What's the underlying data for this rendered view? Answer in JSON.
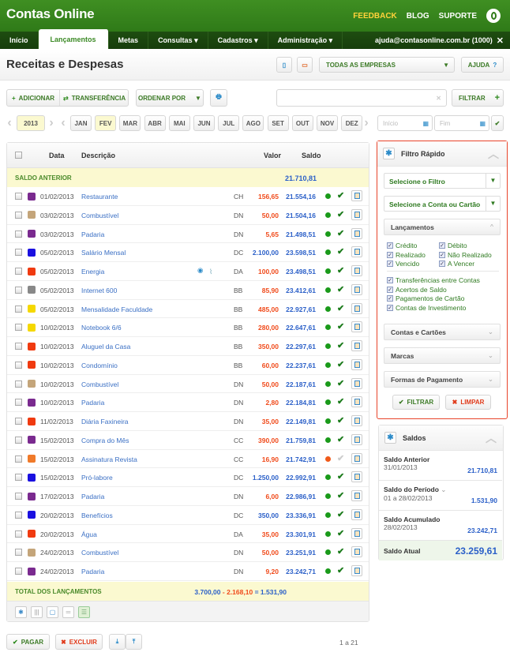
{
  "app": {
    "title": "Contas Online",
    "links": [
      "FEEDBACK",
      "BLOG",
      "SUPORTE"
    ]
  },
  "nav": {
    "items": [
      "Início",
      "Lançamentos",
      "Metas",
      "Consultas ▾",
      "Cadastros ▾",
      "Administração ▾"
    ],
    "active": 1,
    "user": "ajuda@contasonline.com.br (1000)"
  },
  "page": {
    "title": "Receitas e Despesas",
    "company_select": "TODAS AS EMPRESAS",
    "help": "AJUDA"
  },
  "toolbar": {
    "add": "ADICIONAR",
    "transfer": "TRANSFERÊNCIA",
    "order": "ORDENAR POR",
    "search_value": "",
    "filter": "FILTRAR"
  },
  "period": {
    "year": "2013",
    "months": [
      "JAN",
      "FEV",
      "MAR",
      "ABR",
      "MAI",
      "JUN",
      "JUL",
      "AGO",
      "SET",
      "OUT",
      "NOV",
      "DEZ"
    ],
    "selected_month": "FEV",
    "start_placeholder": "Início",
    "end_placeholder": "Fim"
  },
  "table": {
    "headers": {
      "data": "Data",
      "descricao": "Descrição",
      "valor": "Valor",
      "saldo": "Saldo"
    },
    "saldo_anterior": {
      "label": "SALDO ANTERIOR",
      "value": "21.710,81"
    },
    "rows": [
      {
        "date": "01/02/2013",
        "color": "#7a2a8f",
        "desc": "Restaurante",
        "code": "CH",
        "value": "156,65",
        "type": "debit",
        "saldo": "21.554,16",
        "status": "green",
        "paid": true
      },
      {
        "date": "03/02/2013",
        "color": "#c4a57a",
        "desc": "Combustível",
        "code": "DN",
        "value": "50,00",
        "type": "debit",
        "saldo": "21.504,16",
        "status": "green",
        "paid": true
      },
      {
        "date": "03/02/2013",
        "color": "#7a2a8f",
        "desc": "Padaria",
        "code": "DN",
        "value": "5,65",
        "type": "debit",
        "saldo": "21.498,51",
        "status": "green",
        "paid": true
      },
      {
        "date": "05/02/2013",
        "color": "#1a10e0",
        "desc": "Salário Mensal",
        "code": "DC",
        "value": "2.100,00",
        "type": "credit",
        "saldo": "23.598,51",
        "status": "green",
        "paid": true
      },
      {
        "date": "05/02/2013",
        "color": "#f03a10",
        "desc": "Energia",
        "code": "DA",
        "value": "100,00",
        "type": "debit",
        "saldo": "23.498,51",
        "status": "green",
        "paid": true,
        "icons": [
          "comment-icon",
          "attachment-icon"
        ]
      },
      {
        "date": "05/02/2013",
        "color": "#888888",
        "desc": "Internet 600",
        "code": "BB",
        "value": "85,90",
        "type": "debit",
        "saldo": "23.412,61",
        "status": "green",
        "paid": true
      },
      {
        "date": "05/02/2013",
        "color": "#f5d800",
        "desc": "Mensalidade Faculdade",
        "code": "BB",
        "value": "485,00",
        "type": "debit",
        "saldo": "22.927,61",
        "status": "green",
        "paid": true
      },
      {
        "date": "10/02/2013",
        "color": "#f5d800",
        "desc": "Notebook 6/6",
        "code": "BB",
        "value": "280,00",
        "type": "debit",
        "saldo": "22.647,61",
        "status": "green",
        "paid": true
      },
      {
        "date": "10/02/2013",
        "color": "#f03a10",
        "desc": "Aluguel da Casa",
        "code": "BB",
        "value": "350,00",
        "type": "debit",
        "saldo": "22.297,61",
        "status": "green",
        "paid": true
      },
      {
        "date": "10/02/2013",
        "color": "#f03a10",
        "desc": "Condomínio",
        "code": "BB",
        "value": "60,00",
        "type": "debit",
        "saldo": "22.237,61",
        "status": "green",
        "paid": true
      },
      {
        "date": "10/02/2013",
        "color": "#c4a57a",
        "desc": "Combustível",
        "code": "DN",
        "value": "50,00",
        "type": "debit",
        "saldo": "22.187,61",
        "status": "green",
        "paid": true
      },
      {
        "date": "10/02/2013",
        "color": "#7a2a8f",
        "desc": "Padaria",
        "code": "DN",
        "value": "2,80",
        "type": "debit",
        "saldo": "22.184,81",
        "status": "green",
        "paid": true
      },
      {
        "date": "11/02/2013",
        "color": "#f03a10",
        "desc": "Diária Faxineira",
        "code": "DN",
        "value": "35,00",
        "type": "debit",
        "saldo": "22.149,81",
        "status": "green",
        "paid": true
      },
      {
        "date": "15/02/2013",
        "color": "#7a2a8f",
        "desc": "Compra do Mês",
        "code": "CC",
        "value": "390,00",
        "type": "debit",
        "saldo": "21.759,81",
        "status": "green",
        "paid": true
      },
      {
        "date": "15/02/2013",
        "color": "#f07a2a",
        "desc": "Assinatura Revista",
        "code": "CC",
        "value": "16,90",
        "type": "debit",
        "saldo": "21.742,91",
        "status": "orange",
        "paid": false
      },
      {
        "date": "15/02/2013",
        "color": "#1a10e0",
        "desc": "Pró-labore",
        "code": "DC",
        "value": "1.250,00",
        "type": "credit",
        "saldo": "22.992,91",
        "status": "green",
        "paid": true
      },
      {
        "date": "17/02/2013",
        "color": "#7a2a8f",
        "desc": "Padaria",
        "code": "DN",
        "value": "6,00",
        "type": "debit",
        "saldo": "22.986,91",
        "status": "green",
        "paid": true
      },
      {
        "date": "20/02/2013",
        "color": "#1a10e0",
        "desc": "Benefícios",
        "code": "DC",
        "value": "350,00",
        "type": "credit",
        "saldo": "23.336,91",
        "status": "green",
        "paid": true
      },
      {
        "date": "20/02/2013",
        "color": "#f03a10",
        "desc": "Água",
        "code": "DA",
        "value": "35,00",
        "type": "debit",
        "saldo": "23.301,91",
        "status": "green",
        "paid": true
      },
      {
        "date": "24/02/2013",
        "color": "#c4a57a",
        "desc": "Combustível",
        "code": "DN",
        "value": "50,00",
        "type": "debit",
        "saldo": "23.251,91",
        "status": "green",
        "paid": true
      },
      {
        "date": "24/02/2013",
        "color": "#7a2a8f",
        "desc": "Padaria",
        "code": "DN",
        "value": "9,20",
        "type": "debit",
        "saldo": "23.242,71",
        "status": "green",
        "paid": true
      }
    ],
    "total": {
      "label": "TOTAL DOS LANÇAMENTOS",
      "credits": "3.700,00",
      "minus": "-",
      "debits": "2.168,10",
      "equals": "=",
      "result": "1.531,90"
    }
  },
  "bottom": {
    "pay": "PAGAR",
    "delete": "EXCLUIR",
    "pagination": "1 a 21"
  },
  "filter": {
    "title": "Filtro Rápido",
    "select_filter": "Selecione o Filtro",
    "select_account": "Selecione a Conta ou Cartão",
    "lancamentos": "Lançamentos",
    "checks_grid": [
      "Crédito",
      "Débito",
      "Realizado",
      "Não Realizado",
      "Vencido",
      "A Vencer"
    ],
    "checks_list": [
      "Transferências entre Contas",
      "Acertos de Saldo",
      "Pagamentos de Cartão",
      "Contas de Investimento"
    ],
    "sections": [
      "Contas e Cartões",
      "Marcas",
      "Formas de Pagamento"
    ],
    "apply": "FILTRAR",
    "clear": "LIMPAR"
  },
  "saldos": {
    "title": "Saldos",
    "items": [
      {
        "label": "Saldo Anterior",
        "date": "31/01/2013",
        "value": "21.710,81"
      },
      {
        "label": "Saldo do Período",
        "date": "01 a 28/02/2013",
        "value": "1.531,90"
      },
      {
        "label": "Saldo Acumulado",
        "date": "28/02/2013",
        "value": "23.242,71"
      }
    ],
    "current_label": "Saldo Atual",
    "current_value": "23.259,61"
  },
  "colors": {
    "brand": "#3a8a22",
    "credit": "#2a5fc8",
    "debit": "#f04a1a",
    "highlight": "#fbf9d0",
    "filter_border": "#e8442a"
  }
}
